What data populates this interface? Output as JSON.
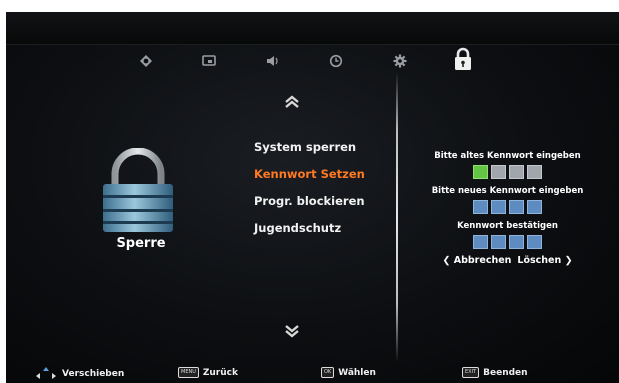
{
  "top_icons": [
    {
      "name": "picture-icon"
    },
    {
      "name": "screen-icon"
    },
    {
      "name": "sound-icon"
    },
    {
      "name": "clock-icon"
    },
    {
      "name": "gear-icon"
    },
    {
      "name": "lock-icon",
      "selected": true
    }
  ],
  "left_panel": {
    "title": "Sperre",
    "icon": "padlock-icon"
  },
  "menu": {
    "items": [
      {
        "label": "System sperren",
        "active": false
      },
      {
        "label": "Kennwort Setzen",
        "active": true
      },
      {
        "label": "Progr. blockieren",
        "active": false
      },
      {
        "label": "Jugendschutz",
        "active": false
      }
    ],
    "active_color": "#ff7a22"
  },
  "password": {
    "old_label": "Bitte altes Kennwort eingeben",
    "old_digits_entered": 1,
    "new_label": "Bitte neues Kennwort eingeben",
    "confirm_label": "Kennwort bestätigen",
    "digits": 4,
    "cancel_label": "Abbrechen",
    "delete_label": "Löschen"
  },
  "bottom_bar": {
    "move_label": "Verschieben",
    "back_key": "MENU",
    "back_label": "Zurück",
    "ok_key": "OK",
    "ok_label": "Wählen",
    "exit_key": "EXIT",
    "exit_label": "Beenden"
  },
  "colors": {
    "background": "#0c0e11",
    "digit_box": "#5f8cc0",
    "digit_filled": "#63c446",
    "text": "#ffffff"
  }
}
